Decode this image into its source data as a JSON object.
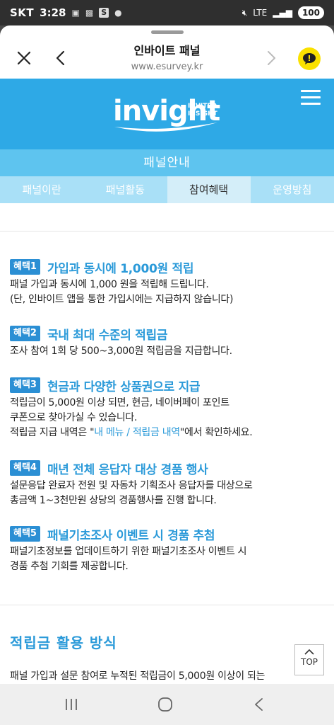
{
  "status_bar": {
    "carrier": "SKT",
    "time": "3:28",
    "network": "LTE",
    "battery": "100"
  },
  "browser": {
    "title": "인바이트 패널",
    "url": "www.esurvey.kr"
  },
  "site": {
    "logo_main": "invight",
    "logo_sub_1": "INVITED",
    "logo_sub_2": "INSIGHT",
    "section_title": "패널안내",
    "tabs": [
      {
        "label": "패널이란",
        "active": false
      },
      {
        "label": "패널활동",
        "active": false
      },
      {
        "label": "참여혜택",
        "active": true
      },
      {
        "label": "운영방침",
        "active": false
      }
    ]
  },
  "benefits": [
    {
      "badge": "혜택1",
      "title": "가입과 동시에 1,000원 적립",
      "lines": [
        "패널 가입과 동시에 1,000 원을 적립해 드립니다.",
        "(단, 인바이트 앱을 통한 가입시에는 지급하지 않습니다)"
      ]
    },
    {
      "badge": "혜택2",
      "title": "국내 최대 수준의 적립금",
      "lines": [
        "조사 참여 1회 당 500~3,000원 적립금을 지급합니다."
      ]
    },
    {
      "badge": "혜택3",
      "title": "현금과 다양한 상품권으로 지급",
      "lines": [
        "적립금이 5,000원 이상 되면, 현금, 네이버페이 포인트",
        "쿠폰으로 찾아가실 수 있습니다."
      ],
      "line_link_prefix": "적립금 지급 내역은 \"",
      "line_link": "내 메뉴 / 적립금 내역",
      "line_link_suffix": "\"에서 확인하세요."
    },
    {
      "badge": "혜택4",
      "title": "매년 전체 응답자 대상 경품 행사",
      "lines": [
        "설문응답 완료자 전원 및 자동차 기획조사 응답자를 대상으로",
        "총금액 1~3천만원 상당의 경품행사를 진행 합니다."
      ]
    },
    {
      "badge": "혜택5",
      "title": "패널기초조사 이벤트 시 경품 추첨",
      "lines": [
        "패널기초정보를 업데이트하기 위한 패널기초조사 이벤트 시",
        "경품 추첨 기회를 제공합니다."
      ]
    }
  ],
  "usage": {
    "title": "적립금 활용 방식",
    "text": "패널 가입과 설문 참여로 누적된 적립금이 5,000원 이상이 되는"
  },
  "top_button": "TOP",
  "colors": {
    "brand_blue": "#2ea9e6",
    "title_blue": "#2b9ad9",
    "badge_blue": "#2b8fd4",
    "kakao_yellow": "#fae100"
  }
}
